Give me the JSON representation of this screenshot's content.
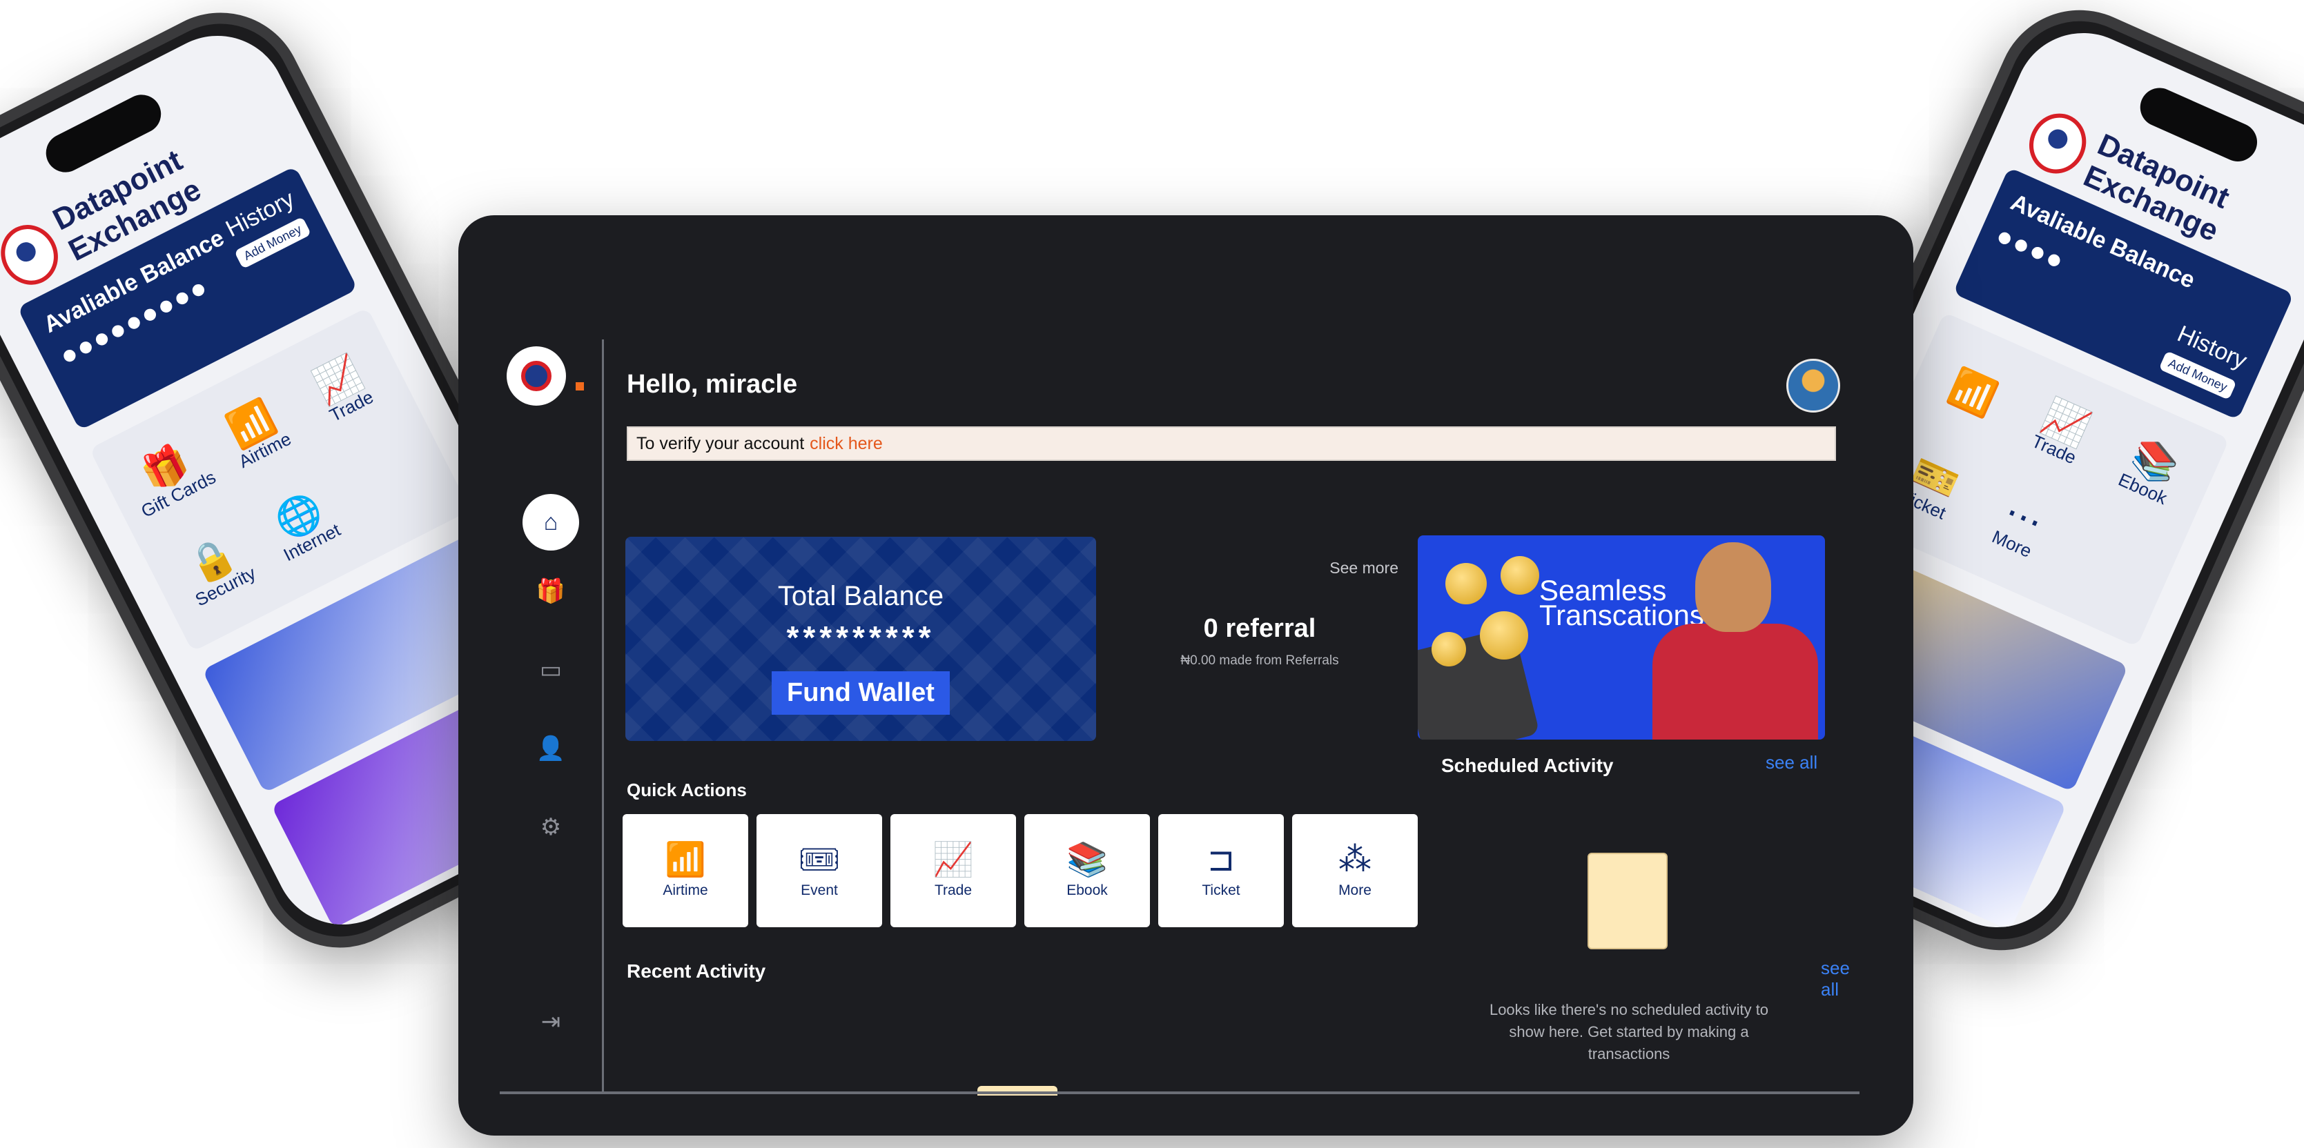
{
  "phones": {
    "left": {
      "brand": "Datapoint Exchange",
      "balance_title": "Avaliable Balance",
      "balance_value": "●●●●●●●●●",
      "history": "History",
      "add_money": "Add Money",
      "items": [
        {
          "label": "Gift Cards",
          "icon": "gift-card-icon",
          "glyph": "🎁"
        },
        {
          "label": "Airtime",
          "icon": "airtime-icon",
          "glyph": "📶"
        },
        {
          "label": "Trade",
          "icon": "trade-icon",
          "glyph": "📈"
        },
        {
          "label": "Security",
          "icon": "security-icon",
          "glyph": "🔒"
        },
        {
          "label": "Internet",
          "icon": "internet-icon",
          "glyph": "🌐"
        },
        {
          "label": "",
          "icon": "",
          "glyph": ""
        }
      ]
    },
    "right": {
      "brand": "Datapoint Exchange",
      "balance_title": "Avaliable Balance",
      "balance_value": "●●●●",
      "history": "History",
      "add_money": "Add Money",
      "items": [
        {
          "label": "",
          "icon": "",
          "glyph": ""
        },
        {
          "label": "Trade",
          "icon": "trade-icon",
          "glyph": "📈"
        },
        {
          "label": "Ebook",
          "icon": "ebook-icon",
          "glyph": "📚"
        },
        {
          "label": "Ticket",
          "icon": "ticket-icon",
          "glyph": "🎫"
        },
        {
          "label": "More",
          "icon": "more-icon",
          "glyph": "⋯"
        },
        {
          "label": "",
          "icon": "",
          "glyph": ""
        }
      ]
    }
  },
  "dashboard": {
    "greeting": "Hello, miracle",
    "verify_text": "To verify your account",
    "verify_link": "click here",
    "total_balance_title": "Total Balance",
    "total_balance_value": "*********",
    "fund_wallet": "Fund Wallet",
    "see_more": "See more",
    "referral_count": "0 referral",
    "referral_made": "₦0.00 made from Referrals",
    "banner_text": "Seamless Transcations",
    "quick_actions_title": "Quick Actions",
    "quick_actions": [
      {
        "label": "Airtime",
        "icon": "airtime-icon",
        "glyph": "📶"
      },
      {
        "label": "Event",
        "icon": "event-ticket-icon",
        "glyph": "🎟"
      },
      {
        "label": "Trade",
        "icon": "trade-icon",
        "glyph": "📈"
      },
      {
        "label": "Ebook",
        "icon": "ebook-icon",
        "glyph": "📚"
      },
      {
        "label": "Ticket",
        "icon": "ticket-icon",
        "glyph": "⊐"
      },
      {
        "label": "More",
        "icon": "more-icon",
        "glyph": "⁂"
      }
    ],
    "scheduled_title": "Scheduled Activity",
    "scheduled_see_all": "see all",
    "scheduled_empty": "Looks like there's no scheduled activity to show here. Get started by making a transactions",
    "recent_title": "Recent Activity",
    "recent_see_all": "see all"
  },
  "sidebar": {
    "items": [
      {
        "icon": "home-icon",
        "glyph": "⌂",
        "active": true
      },
      {
        "icon": "gift-icon",
        "glyph": "🎁",
        "active": false
      },
      {
        "icon": "card-icon",
        "glyph": "▭",
        "active": false
      },
      {
        "icon": "user-icon",
        "glyph": "👤",
        "active": false
      },
      {
        "icon": "settings-icon",
        "glyph": "⚙",
        "active": false
      }
    ],
    "logout_icon": "logout-icon",
    "logout_glyph": "⇥"
  },
  "colors": {
    "brand_navy": "#102a6b",
    "accent_blue": "#3b82f6",
    "verify_link": "#e4571b",
    "background": "#1c1d21"
  }
}
